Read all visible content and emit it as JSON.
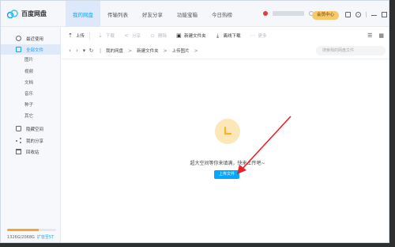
{
  "app": {
    "name": "百度网盘",
    "brand_color": "#06a7ff"
  },
  "nav": {
    "tabs": [
      {
        "label": "我的网盘",
        "active": true
      },
      {
        "label": "传输列表"
      },
      {
        "label": "好友分享"
      },
      {
        "label": "功能宝箱"
      },
      {
        "label": "今日热榜"
      }
    ]
  },
  "user": {
    "member_button": "会员中心"
  },
  "sidebar": {
    "recent": "最近使用",
    "all_files": "全部文件",
    "sub": [
      "图片",
      "视频",
      "文档",
      "音乐",
      "种子",
      "其它"
    ],
    "hidden_space": "隐藏空间",
    "my_share": "我的分享",
    "recycle": "回收站"
  },
  "storage": {
    "used_text": "1326G/2068G",
    "expand": "扩容至5T",
    "used_fraction": 0.64
  },
  "toolbar": {
    "upload": "上传",
    "download": "下载",
    "share": "分享",
    "delete": "删除",
    "new_folder": "新建文件夹",
    "offline_download": "离线下载",
    "more": "更多"
  },
  "address": {
    "crumbs": [
      "我的网盘",
      "新建文件夹",
      "上传图片"
    ],
    "search_placeholder": "搜索我的网盘文件"
  },
  "empty": {
    "message": "超大空间等你来填满，快来上传吧~",
    "upload_button": "上传文件"
  }
}
